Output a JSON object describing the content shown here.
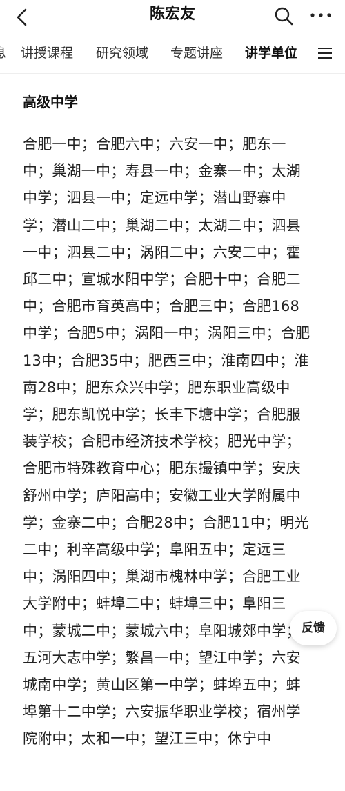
{
  "header": {
    "title": "陈宏友"
  },
  "tabs": [
    {
      "label": "息"
    },
    {
      "label": "讲授课程"
    },
    {
      "label": "研究领域"
    },
    {
      "label": "专题讲座"
    },
    {
      "label": "讲学单位"
    }
  ],
  "active_tab": "讲学单位",
  "section": {
    "title": "高级中学",
    "content": "合肥一中；合肥六中；六安一中；肥东一中；巢湖一中；寿县一中；金寨一中；太湖中学；泗县一中；定远中学；潜山野寨中学；潜山二中；巢湖二中；太湖二中；泗县一中；泗县二中；涡阳二中；六安二中；霍邱二中；宣城水阳中学；合肥十中；合肥二中；合肥市育英高中；合肥三中；合肥168中学；合肥5中；涡阳一中；涡阳三中；合肥13中；合肥35中；肥西三中；淮南四中；淮南28中；肥东众兴中学；肥东职业高级中学；肥东凯悦中学；长丰下塘中学；合肥服装学校；合肥市经济技术学校；肥光中学；合肥市特殊教育中心；肥东撮镇中学；安庆舒州中学；庐阳高中；安徽工业大学附属中学；金寨二中；合肥28中；合肥11中；明光二中；利辛高级中学；阜阳五中；定远三中；涡阳四中；巢湖市槐林中学；合肥工业大学附中；蚌埠二中；蚌埠三中；阜阳三中；蒙城二中；蒙城六中；阜阳城郊中学；五河大志中学；繁昌一中；望江中学；六安城南中学；黄山区第一中学；蚌埠五中；蚌埠第十二中学；六安振华职业学校；宿州学院附中；太和一中；望江三中；休宁中"
  },
  "feedback": {
    "label": "反馈"
  },
  "icons": {
    "back": "back-arrow-icon",
    "search": "search-icon",
    "more": "more-icon",
    "menu": "menu-icon"
  }
}
